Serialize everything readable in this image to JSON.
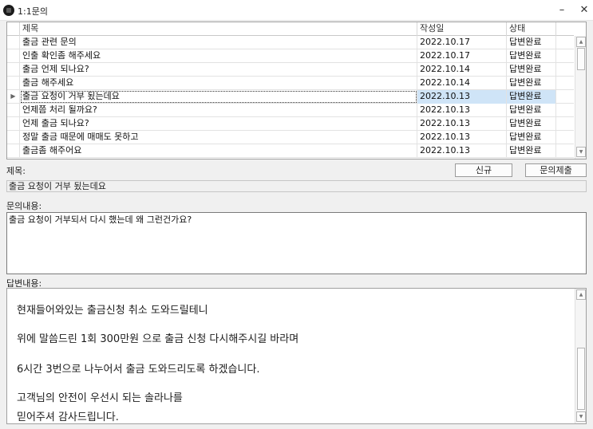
{
  "window": {
    "title": "1:1문의",
    "minimize_glyph": "–",
    "close_glyph": "✕"
  },
  "grid": {
    "columns": [
      "",
      "제목",
      "작성일",
      "상태",
      ""
    ],
    "rows": [
      {
        "title": "출금 관련 문의",
        "date": "2022.10.17",
        "status": "답변완료"
      },
      {
        "title": "인출 확인좀 해주세요",
        "date": "2022.10.17",
        "status": "답변완료"
      },
      {
        "title": "출금 언제 되나요?",
        "date": "2022.10.14",
        "status": "답변완료"
      },
      {
        "title": "출금 해주세요",
        "date": "2022.10.14",
        "status": "답변완료"
      },
      {
        "title": "출금 요청이 거부 됬는데요",
        "date": "2022.10.13",
        "status": "답변완료"
      },
      {
        "title": "언제쯤 처리 될까요?",
        "date": "2022.10.13",
        "status": "답변완료"
      },
      {
        "title": "언제 출금 되나요?",
        "date": "2022.10.13",
        "status": "답변완료"
      },
      {
        "title": "정말 출금 때문에 매매도 못하고",
        "date": "2022.10.13",
        "status": "답변완료"
      },
      {
        "title": "출금좀 해주어요",
        "date": "2022.10.13",
        "status": "답변완료"
      }
    ],
    "current_row_marker": "▶"
  },
  "form": {
    "subject_label": "제목:",
    "subject_value": "출금 요청이 거부 됬는데요",
    "new_button": "신규",
    "submit_button": "문의제출",
    "content_label": "문의내용:",
    "content_value": "출금 요청이 거부되서 다시 했는데 왜 그런건가요?",
    "answer_label": "답변내용:",
    "answer_lines": [
      "현재들어와있는 출금신청 취소 도와드릴테니",
      "위에 말씀드린 1회 300만원 으로 출금 신청 다시해주시길 바라며",
      "6시간 3번으로 나누어서 출금 도와드리도록 하겠습니다.",
      "고객님의 안전이 우선시 되는 솔라나를",
      "믿어주셔 감사드립니다."
    ]
  },
  "icons": {
    "scroll_up": "▲",
    "scroll_down": "▼"
  }
}
